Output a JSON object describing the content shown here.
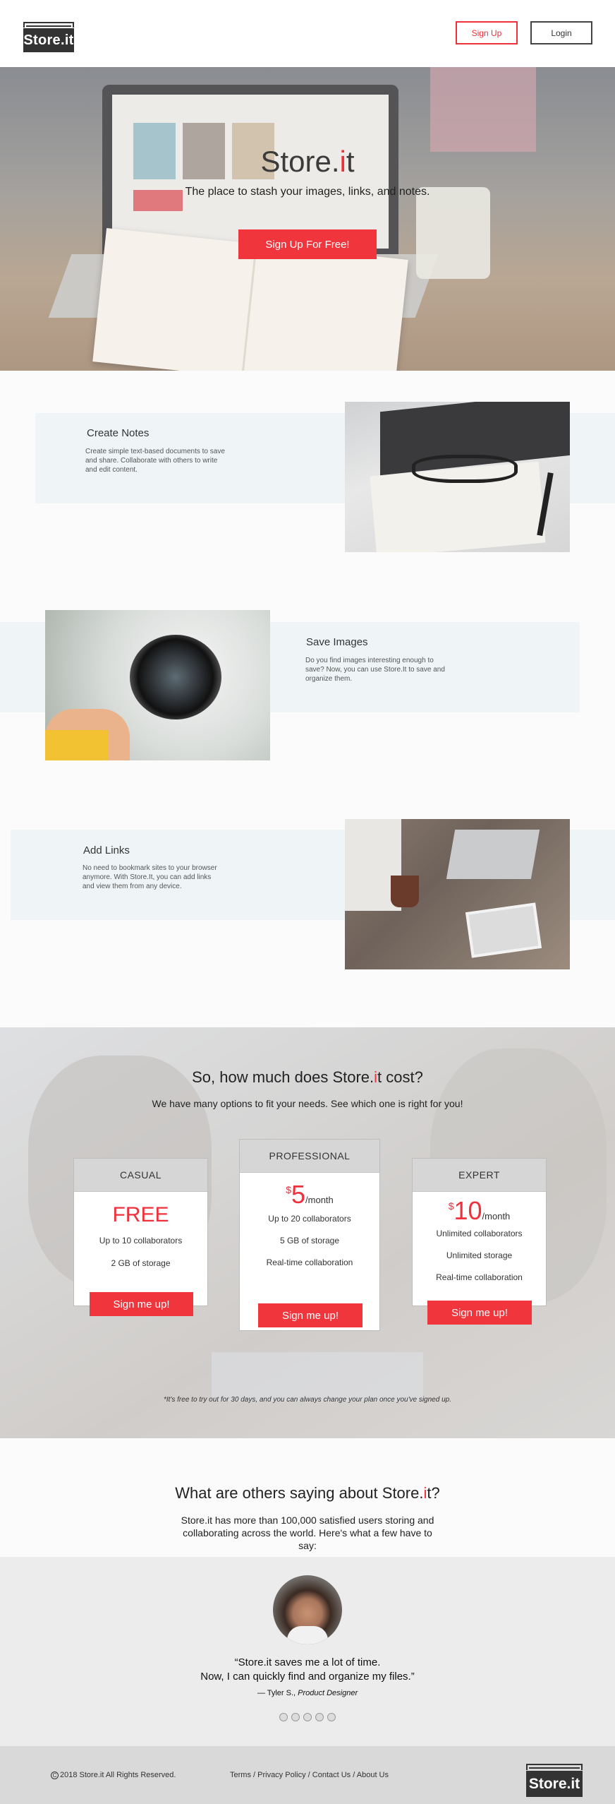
{
  "header": {
    "logo_text": "Store.it",
    "signup_label": "Sign Up",
    "login_label": "Login"
  },
  "hero": {
    "title_main": "Store.",
    "title_dot": "i",
    "title_end": "t",
    "tagline": "The place to stash your images, links, and notes.",
    "cta_label": "Sign Up For Free!"
  },
  "features": [
    {
      "title": "Create Notes",
      "text": "Create simple text-based documents to save and share.  Collaborate with others to write and edit content."
    },
    {
      "title": "Save Images",
      "text": "Do you find images interesting enough to save? Now, you can use Store.It to save and organize them."
    },
    {
      "title": "Add Links",
      "text": "No need to bookmark sites to your browser anymore. With Store.It, you can add links and view them from any device."
    }
  ],
  "pricing": {
    "title_pre": "So, how much does Store.",
    "title_dot": "i",
    "title_post": "t cost?",
    "subtitle": "We have many options to fit your needs. See which one is right for you!",
    "plans": [
      {
        "name": "CASUAL",
        "price": "FREE",
        "currency": "",
        "period": "",
        "features": [
          "Up to 10 collaborators",
          "2 GB of storage"
        ],
        "button": "Sign me up!"
      },
      {
        "name": "PROFESSIONAL",
        "price": "5",
        "currency": "$",
        "period": "/month",
        "features": [
          "Up to 20 collaborators",
          "5 GB of storage",
          "Real-time collaboration"
        ],
        "button": "Sign me up!"
      },
      {
        "name": "EXPERT",
        "price": "10",
        "currency": "$",
        "period": "/month",
        "features": [
          "Unlimited collaborators",
          "Unlimited storage",
          "Real-time collaboration"
        ],
        "button": "Sign me up!"
      }
    ],
    "note": "*It's free to try out for 30 days, and you can always change your plan once you've signed up."
  },
  "testimonials": {
    "title_pre": "What are others saying about Store.",
    "title_dot": "i",
    "title_post": "t?",
    "subtitle": "Store.it has more than 100,000 satisfied users storing and collaborating across the world. Here's what a few have to say:",
    "quote_line1": "“Store.it saves me a lot of time.",
    "quote_line2": "Now, I can quickly find and organize my files.”",
    "author_name": "—  Tyler S.,",
    "author_role": "Product Designer"
  },
  "footer": {
    "copyright": "2018 Store.it All Rights Reserved.",
    "copyright_symbol": "C",
    "links": [
      "Terms",
      "Privacy Policy",
      "Contact Us",
      "About Us"
    ],
    "logo_text": "Store.it"
  },
  "colors": {
    "accent": "#f0353d",
    "feature_band": "#eff5f7",
    "footer_bg": "#d9d9d9"
  }
}
